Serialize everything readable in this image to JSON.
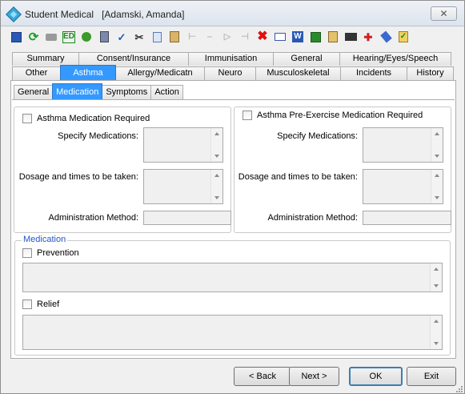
{
  "window": {
    "title": "Student Medical",
    "student": "[Adamski, Amanda]",
    "close_glyph": "✕"
  },
  "toolbar": {
    "icons": [
      "save-icon",
      "refresh-icon",
      "print-icon",
      "ed-icon",
      "tree-icon",
      "calculator-icon",
      "spellcheck-icon",
      "cut-icon",
      "copy-icon",
      "paste-icon",
      "first-record-icon",
      "previous-record-icon",
      "next-record-icon",
      "last-record-icon",
      "delete-icon",
      "mail-icon",
      "word-icon",
      "grid-icon",
      "clipboard-icon",
      "film-icon",
      "medical-icon",
      "tag-icon",
      "checklist-icon"
    ],
    "ed_label": "ED"
  },
  "tabs": {
    "row1": [
      "Summary",
      "Consent/Insurance",
      "Immunisation",
      "General",
      "Hearing/Eyes/Speech"
    ],
    "row2": [
      "Other",
      "Asthma",
      "Allergy/Medicatn",
      "Neuro",
      "Musculoskeletal",
      "Incidents",
      "History"
    ],
    "active": "Asthma"
  },
  "subtabs": {
    "items": [
      "General",
      "Medication",
      "Symptoms",
      "Action"
    ],
    "active": "Medication"
  },
  "left_group": {
    "checkbox_label": "Asthma Medication Required",
    "specify_label": "Specify Medications:",
    "dosage_label": "Dosage and times to be taken:",
    "admin_label": "Administration Method:"
  },
  "right_group": {
    "checkbox_label": "Asthma Pre-Exercise Medication Required",
    "specify_label": "Specify Medications:",
    "dosage_label": "Dosage and times to be taken:",
    "admin_label": "Administration Method:"
  },
  "medication_group": {
    "legend": "Medication",
    "prevention_label": "Prevention",
    "relief_label": "Relief"
  },
  "buttons": {
    "back": "< Back",
    "next": "Next >",
    "ok": "OK",
    "exit": "Exit"
  },
  "colors": {
    "active_tab": "#3399ff",
    "legend_text": "#2255cc"
  }
}
